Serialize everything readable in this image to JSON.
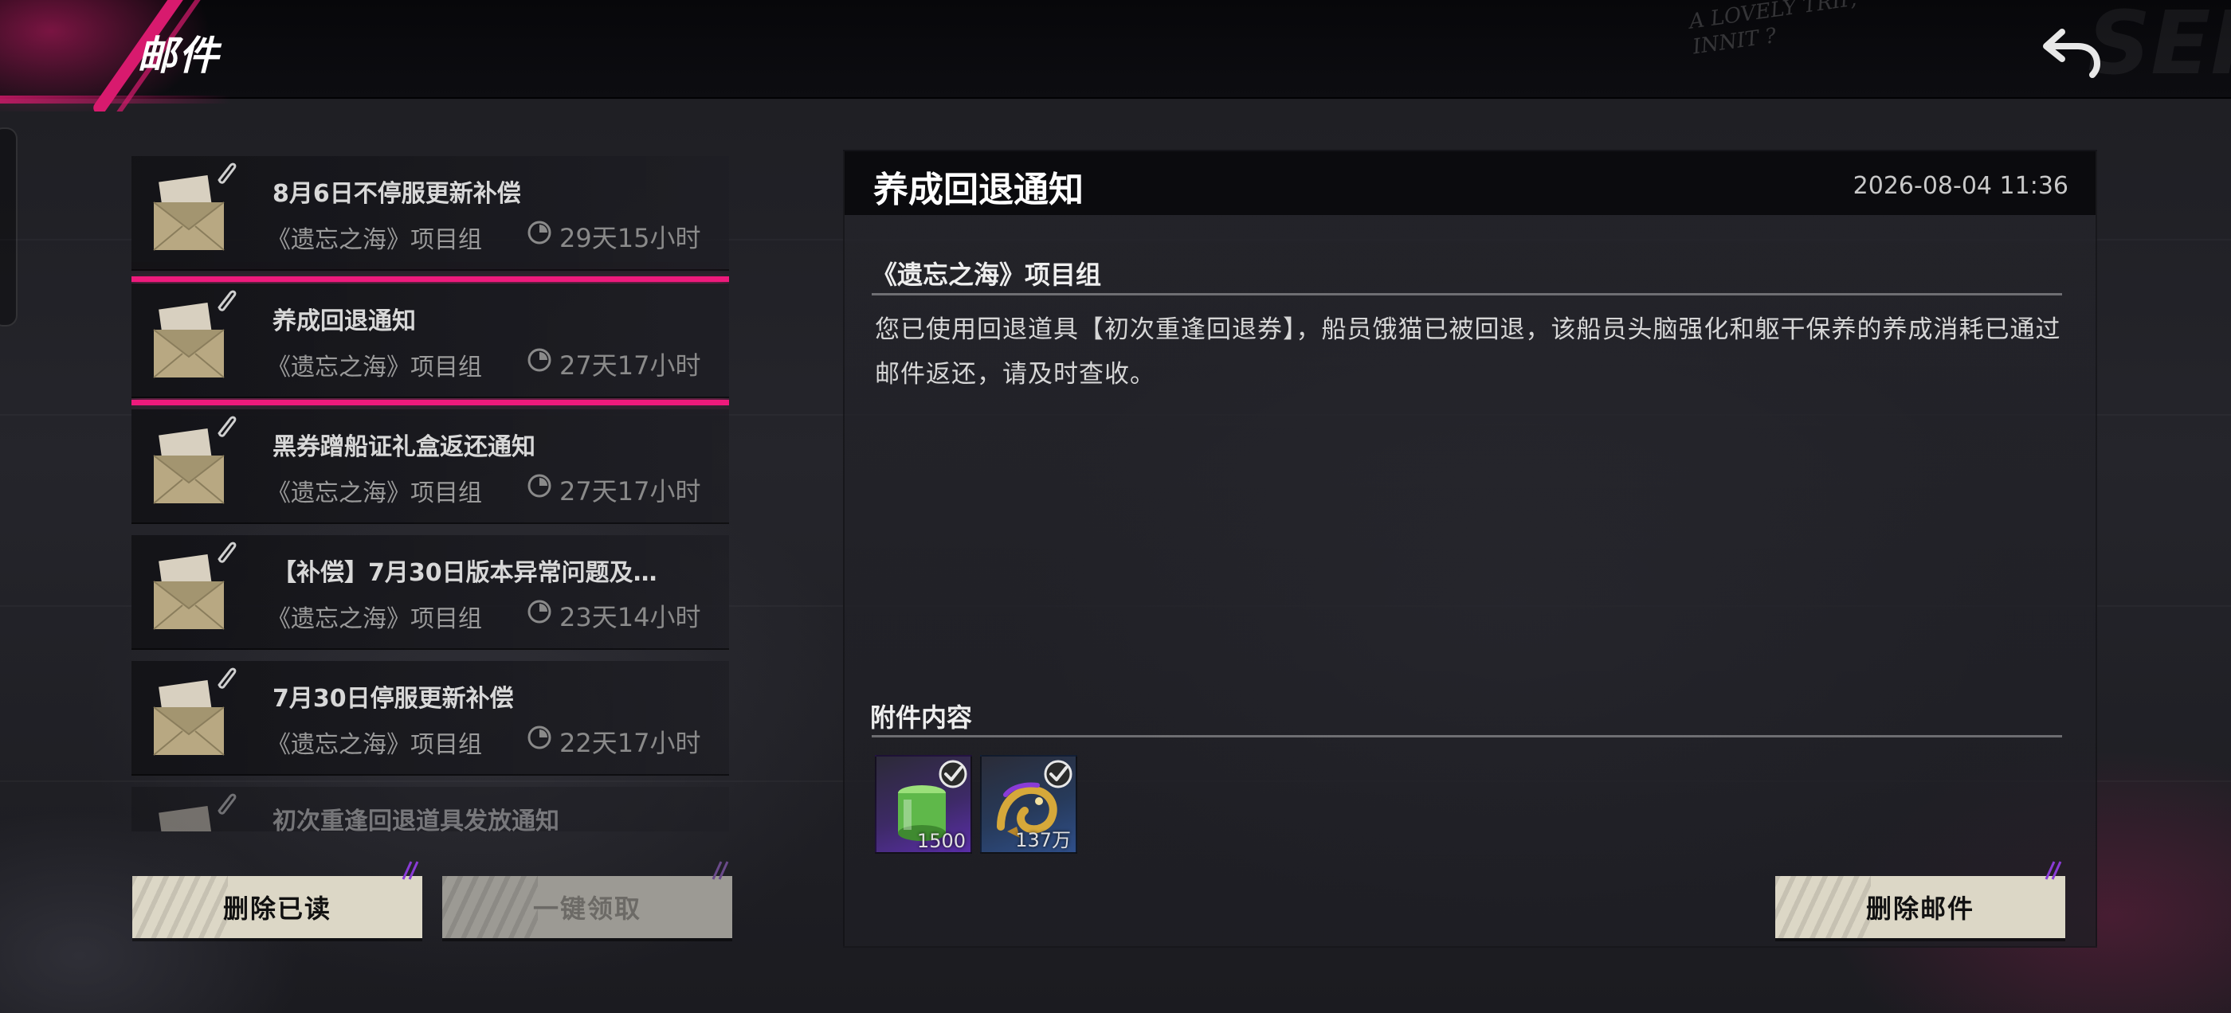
{
  "header": {
    "title": "邮件",
    "corner_text_line1": "A LOVELY TRIP,",
    "corner_text_line2": "INNIT ?",
    "corner_big_text": "SEI"
  },
  "mail_list": [
    {
      "title": "8月6日不停服更新补偿",
      "sender": "《遗忘之海》项目组",
      "expiry": "29天15小时",
      "selected": false
    },
    {
      "title": "养成回退通知",
      "sender": "《遗忘之海》项目组",
      "expiry": "27天17小时",
      "selected": true
    },
    {
      "title": "黑券蹭船证礼盒返还通知",
      "sender": "《遗忘之海》项目组",
      "expiry": "27天17小时",
      "selected": false
    },
    {
      "title": "【补偿】7月30日版本异常问题及…",
      "sender": "《遗忘之海》项目组",
      "expiry": "23天14小时",
      "selected": false
    },
    {
      "title": "7月30日停服更新补偿",
      "sender": "《遗忘之海》项目组",
      "expiry": "22天17小时",
      "selected": false
    },
    {
      "title": "初次重逢回退道具发放通知",
      "sender": "",
      "expiry": "",
      "selected": false
    }
  ],
  "buttons": {
    "delete_read": "删除已读",
    "claim_all": "一键领取",
    "delete_mail": "删除邮件"
  },
  "detail": {
    "title": "养成回退通知",
    "date": "2026-08-04 11:36",
    "sender": "《遗忘之海》项目组",
    "body": "您已使用回退道具【初次重逢回退券】，船员饿猫已被回退，该船员头脑强化和躯干保养的养成消耗已通过邮件返还，请及时查收。",
    "attachments_heading": "附件内容",
    "attachments": [
      {
        "name": "green-canister-item",
        "count": "1500",
        "claimed": true
      },
      {
        "name": "gold-dragon-item",
        "count": "137万",
        "claimed": true
      }
    ]
  },
  "colors": {
    "accent": "#ee1a7c",
    "button_bg": "#dcd7c6",
    "button_disabled_bg": "#9c9a94"
  }
}
